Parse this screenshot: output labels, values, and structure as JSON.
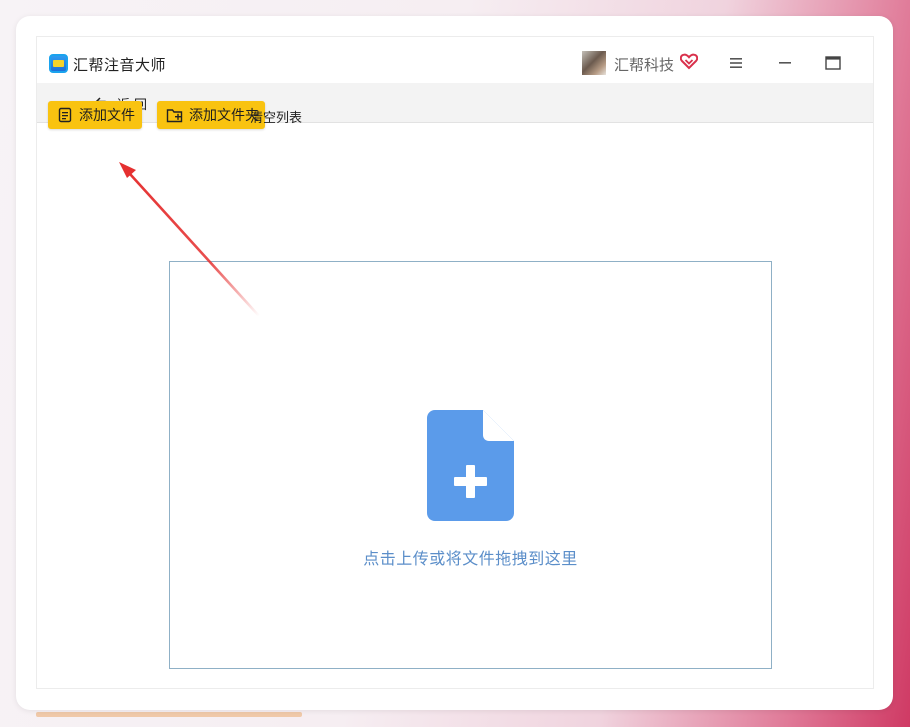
{
  "app": {
    "title": "汇帮注音大师",
    "user_name": "汇帮科技"
  },
  "icons": {
    "logo": "app-logo-icon",
    "heart": "heart-badge-icon",
    "menu": "hamburger-menu-icon",
    "minimize": "minimize-icon",
    "maximize": "maximize-icon",
    "back": "undo-arrow-icon",
    "add_file": "document-list-icon",
    "add_folder": "folder-plus-icon",
    "upload": "file-plus-icon"
  },
  "toolbar": {
    "back_label": "返回"
  },
  "actions": {
    "add_file_label": "添加文件",
    "add_folder_label": "添加文件夹",
    "clear_list_label": "清空列表"
  },
  "dropzone": {
    "hint": "点击上传或将文件拖拽到这里"
  },
  "colors": {
    "accent_yellow": "#f9c310",
    "upload_blue": "#5b9bea",
    "hint_blue": "#5b8ec9",
    "annotation_red": "#e53030"
  }
}
